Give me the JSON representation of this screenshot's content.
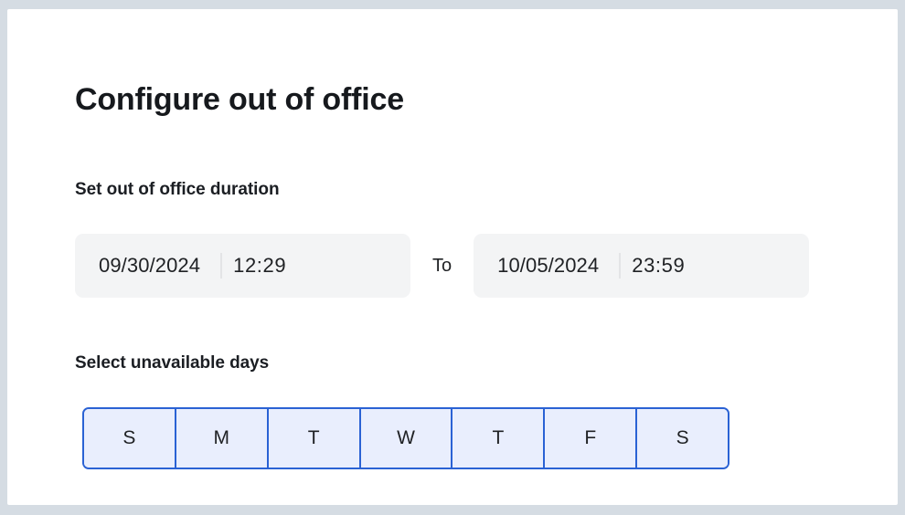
{
  "page": {
    "title": "Configure out of office",
    "background_color": "#d5dce3",
    "card_color": "#ffffff"
  },
  "duration_section": {
    "heading": "Set out of office duration",
    "separator_label": "To",
    "field_background": "#f3f4f5",
    "start": {
      "date": "09/30/2024",
      "time": "12:29"
    },
    "end": {
      "date": "10/05/2024",
      "time": "23:59"
    }
  },
  "days_section": {
    "heading": "Select unavailable days",
    "selected_fill": "#e9eefd",
    "selected_border": "#2a62d4",
    "days": [
      {
        "label": "S",
        "name": "sunday",
        "selected": true
      },
      {
        "label": "M",
        "name": "monday",
        "selected": true
      },
      {
        "label": "T",
        "name": "tuesday",
        "selected": true
      },
      {
        "label": "W",
        "name": "wednesday",
        "selected": true
      },
      {
        "label": "T",
        "name": "thursday",
        "selected": true
      },
      {
        "label": "F",
        "name": "friday",
        "selected": true
      },
      {
        "label": "S",
        "name": "saturday",
        "selected": true
      }
    ]
  }
}
